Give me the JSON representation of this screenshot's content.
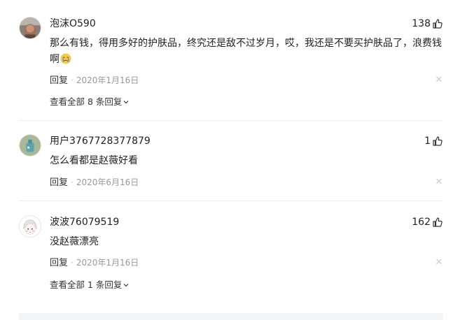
{
  "comments": [
    {
      "username": "泡沫O590",
      "likes": "138",
      "text": "那么有钱，得用多好的护肤品，终究还是敌不过岁月，哎，我还是不要买护肤品了，浪费钱啊",
      "emoji_icon": "crying-face-emoji",
      "reply_label": "回复",
      "date": "2020年1月16日",
      "view_all": "查看全部 8 条回复",
      "avatar_icon": "user-avatar-photo"
    },
    {
      "username": "用户3767728377879",
      "likes": "1",
      "text": "怎么看都是赵薇好看",
      "reply_label": "回复",
      "date": "2020年6月16日",
      "avatar_icon": "default-user-avatar"
    },
    {
      "username": "波波76079519",
      "likes": "162",
      "text": "没赵薇漂亮",
      "reply_label": "回复",
      "date": "2020年1月16日",
      "view_all": "查看全部 1 条回复",
      "avatar_icon": "cartoon-girl-avatar"
    }
  ],
  "icons": {
    "like": "thumbs-up-icon",
    "close": "close-icon",
    "expand": "chevron-down-icon"
  },
  "colors": {
    "text": "#222222",
    "meta": "#999999",
    "divider": "#eeeeee"
  }
}
